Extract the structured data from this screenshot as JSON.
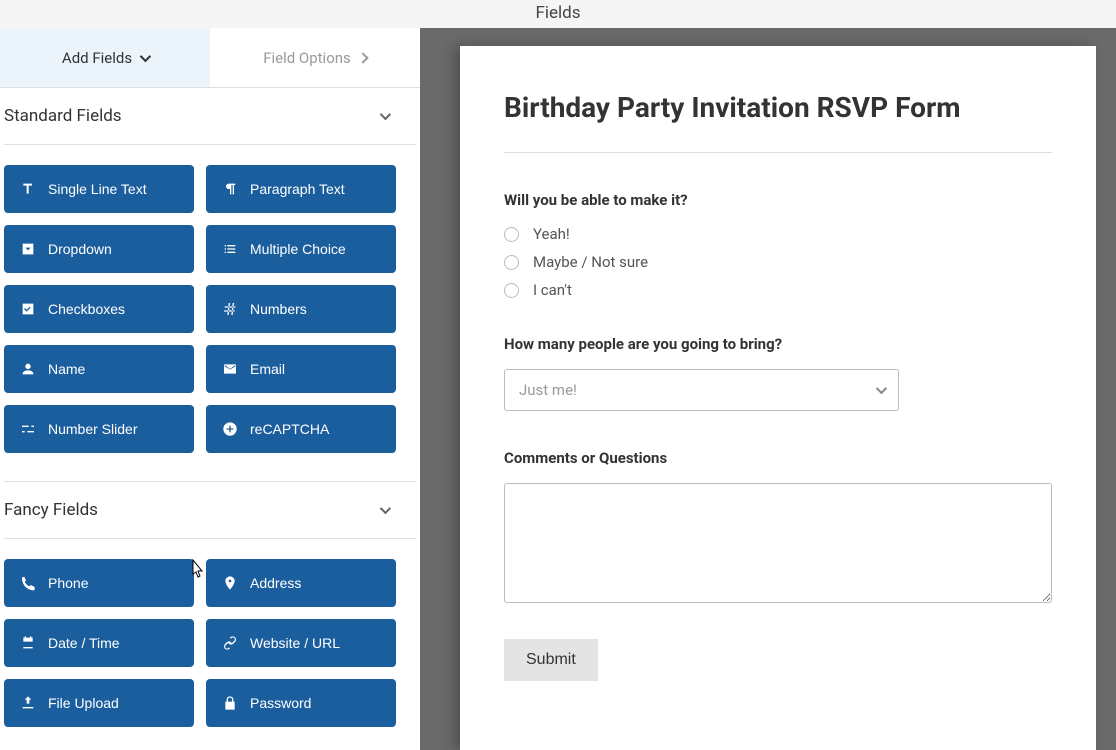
{
  "header": {
    "title": "Fields"
  },
  "tabs": {
    "add": "Add Fields",
    "options": "Field Options"
  },
  "sections": {
    "standard": {
      "title": "Standard Fields",
      "fields": [
        {
          "label": "Single Line Text",
          "icon": "text"
        },
        {
          "label": "Paragraph Text",
          "icon": "paragraph"
        },
        {
          "label": "Dropdown",
          "icon": "caret-square"
        },
        {
          "label": "Multiple Choice",
          "icon": "list"
        },
        {
          "label": "Checkboxes",
          "icon": "check-square"
        },
        {
          "label": "Numbers",
          "icon": "hash"
        },
        {
          "label": "Name",
          "icon": "user"
        },
        {
          "label": "Email",
          "icon": "envelope"
        },
        {
          "label": "Number Slider",
          "icon": "sliders"
        },
        {
          "label": "reCAPTCHA",
          "icon": "google"
        }
      ]
    },
    "fancy": {
      "title": "Fancy Fields",
      "fields": [
        {
          "label": "Phone",
          "icon": "phone"
        },
        {
          "label": "Address",
          "icon": "marker"
        },
        {
          "label": "Date / Time",
          "icon": "calendar"
        },
        {
          "label": "Website / URL",
          "icon": "link"
        },
        {
          "label": "File Upload",
          "icon": "upload"
        },
        {
          "label": "Password",
          "icon": "lock"
        }
      ]
    }
  },
  "form": {
    "title": "Birthday Party Invitation RSVP Form",
    "q1": {
      "label": "Will you be able to make it?",
      "options": [
        "Yeah!",
        "Maybe / Not sure",
        "I can't"
      ]
    },
    "q2": {
      "label": "How many people are you going to bring?",
      "selected": "Just me!"
    },
    "q3": {
      "label": "Comments or Questions"
    },
    "submit": "Submit"
  }
}
